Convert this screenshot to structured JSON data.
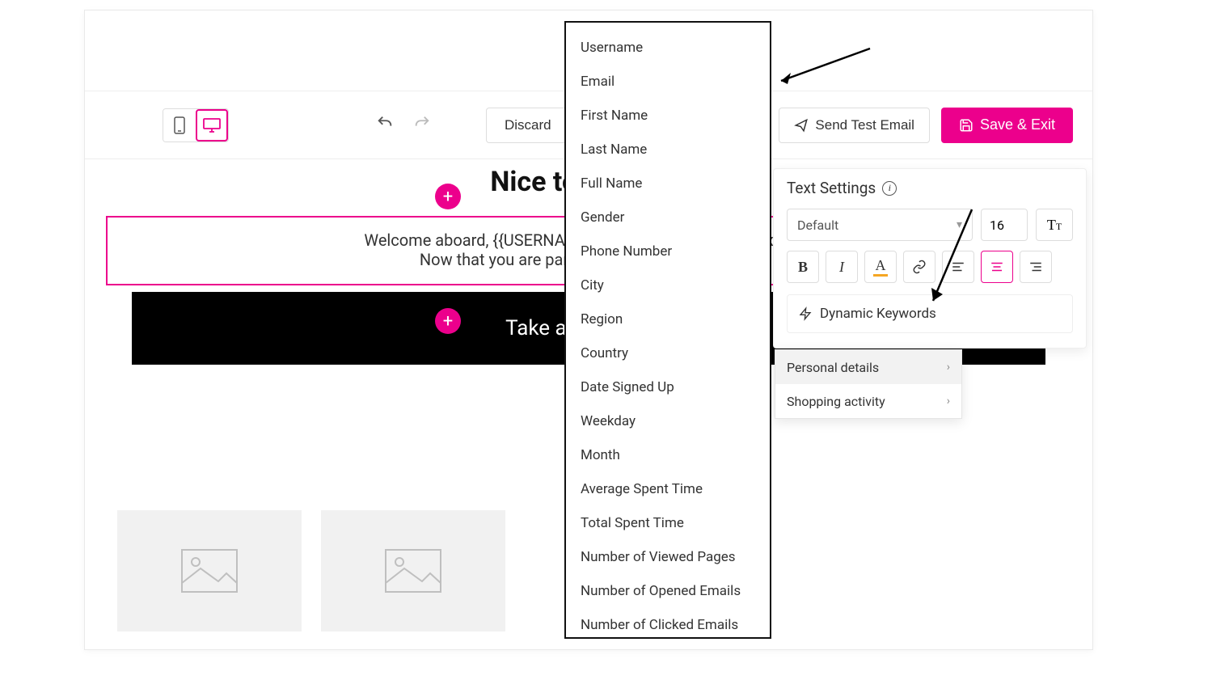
{
  "toolbar": {
    "discard_label": "Discard",
    "send_test_label": "Send Test Email",
    "save_exit_label": "Save & Exit"
  },
  "canvas": {
    "headline": "Nice to see you!",
    "welcome_text": "Welcome aboard, {{USERNAME}}! We couldn't be more excited.\nNow that you are part of us, we will be in touch.",
    "cta_label": "Take another look"
  },
  "settings": {
    "title": "Text Settings",
    "font_family": "Default",
    "font_size": "16",
    "dynamic_keywords_label": "Dynamic Keywords"
  },
  "flyout": {
    "items": [
      "Personal details",
      "Shopping activity"
    ]
  },
  "keywords": [
    "Username",
    "Email",
    "First Name",
    "Last Name",
    "Full Name",
    "Gender",
    "Phone Number",
    "City",
    "Region",
    "Country",
    "Date Signed Up",
    "Weekday",
    "Month",
    "Average Spent Time",
    "Total Spent Time",
    "Number of Viewed Pages",
    "Number of Opened Emails",
    "Number of Clicked Emails"
  ]
}
